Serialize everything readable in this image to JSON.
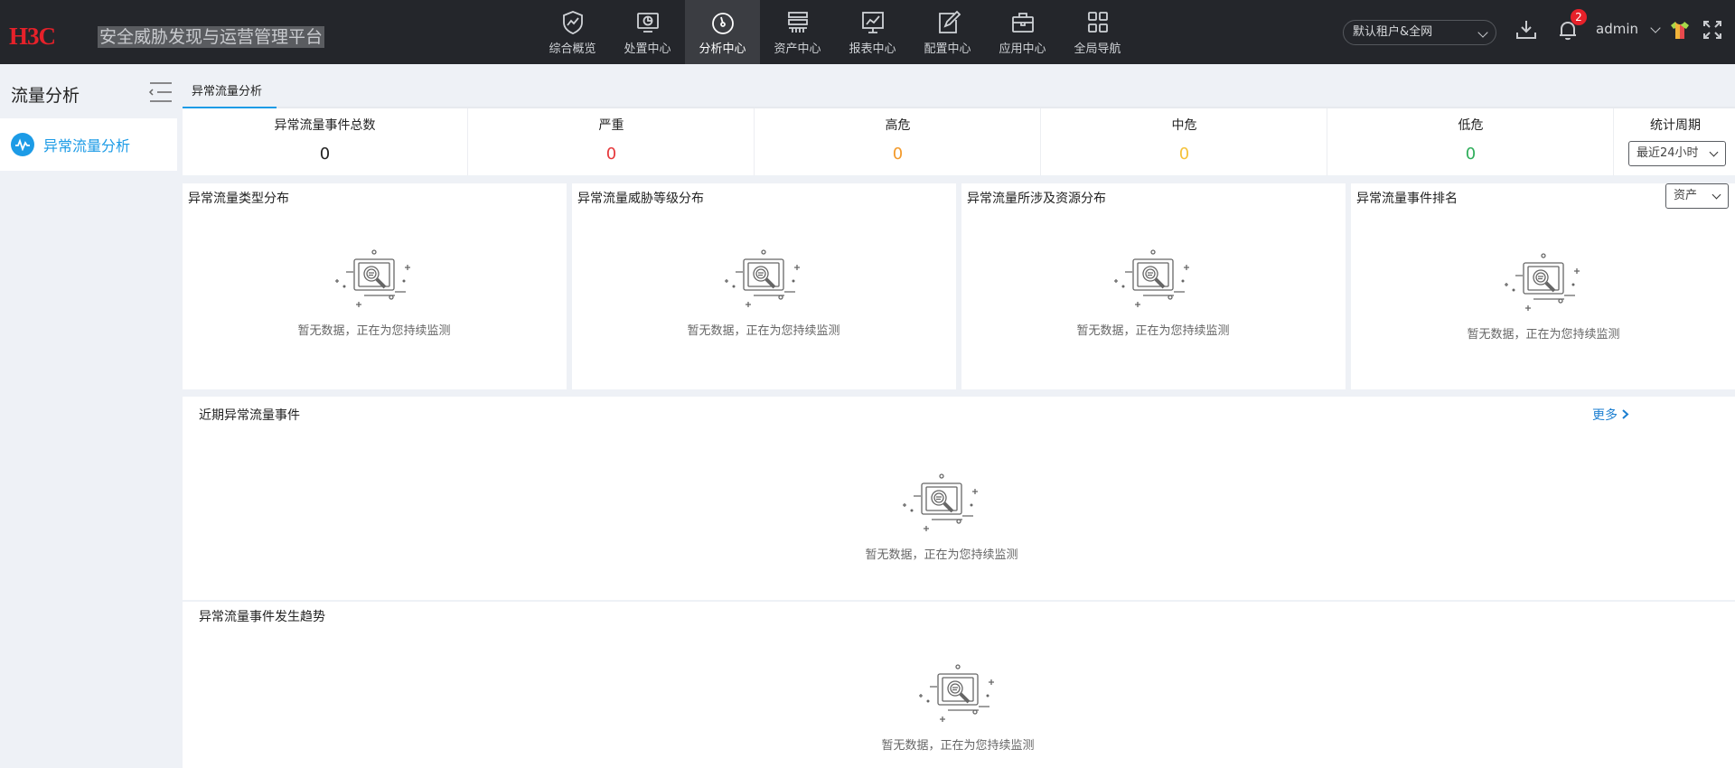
{
  "header": {
    "logo_text": "H3C",
    "platform_title": "安全威胁发现与运营管理平台",
    "nav": [
      {
        "label": "综合概览",
        "icon": "shield-chart-icon"
      },
      {
        "label": "处置中心",
        "icon": "monitor-pie-icon"
      },
      {
        "label": "分析中心",
        "icon": "gauge-icon",
        "active": true
      },
      {
        "label": "资产中心",
        "icon": "server-rack-icon"
      },
      {
        "label": "报表中心",
        "icon": "report-chart-icon"
      },
      {
        "label": "配置中心",
        "icon": "config-edit-icon"
      },
      {
        "label": "应用中心",
        "icon": "briefcase-icon"
      },
      {
        "label": "全局导航",
        "icon": "grid-icon"
      }
    ],
    "tenant_select": "默认租户&全网",
    "notification_count": "2",
    "user": "admin"
  },
  "sidebar": {
    "title": "流量分析",
    "items": [
      {
        "label": "异常流量分析",
        "icon": "pulse-icon"
      }
    ]
  },
  "tabs": [
    {
      "label": "异常流量分析"
    }
  ],
  "stats": [
    {
      "label": "异常流量事件总数",
      "value": "0",
      "color": "#222222"
    },
    {
      "label": "严重",
      "value": "0",
      "color": "#e6383b"
    },
    {
      "label": "高危",
      "value": "0",
      "color": "#f39a2b"
    },
    {
      "label": "中危",
      "value": "0",
      "color": "#f5c23a"
    },
    {
      "label": "低危",
      "value": "0",
      "color": "#2fae5b"
    }
  ],
  "period": {
    "label": "统计周期",
    "selected": "最近24小时"
  },
  "cards": [
    {
      "title": "异常流量类型分布"
    },
    {
      "title": "异常流量威胁等级分布"
    },
    {
      "title": "异常流量所涉及资源分布"
    },
    {
      "title": "异常流量事件排名",
      "select": "资产"
    }
  ],
  "recent": {
    "title": "近期异常流量事件",
    "more": "更多"
  },
  "trend": {
    "title": "异常流量事件发生趋势"
  },
  "empty_text": "暂无数据，正在为您持续监测",
  "colors": {
    "accent": "#1c9be6",
    "topbar": "#24262b",
    "brand_red": "#e6212a"
  }
}
